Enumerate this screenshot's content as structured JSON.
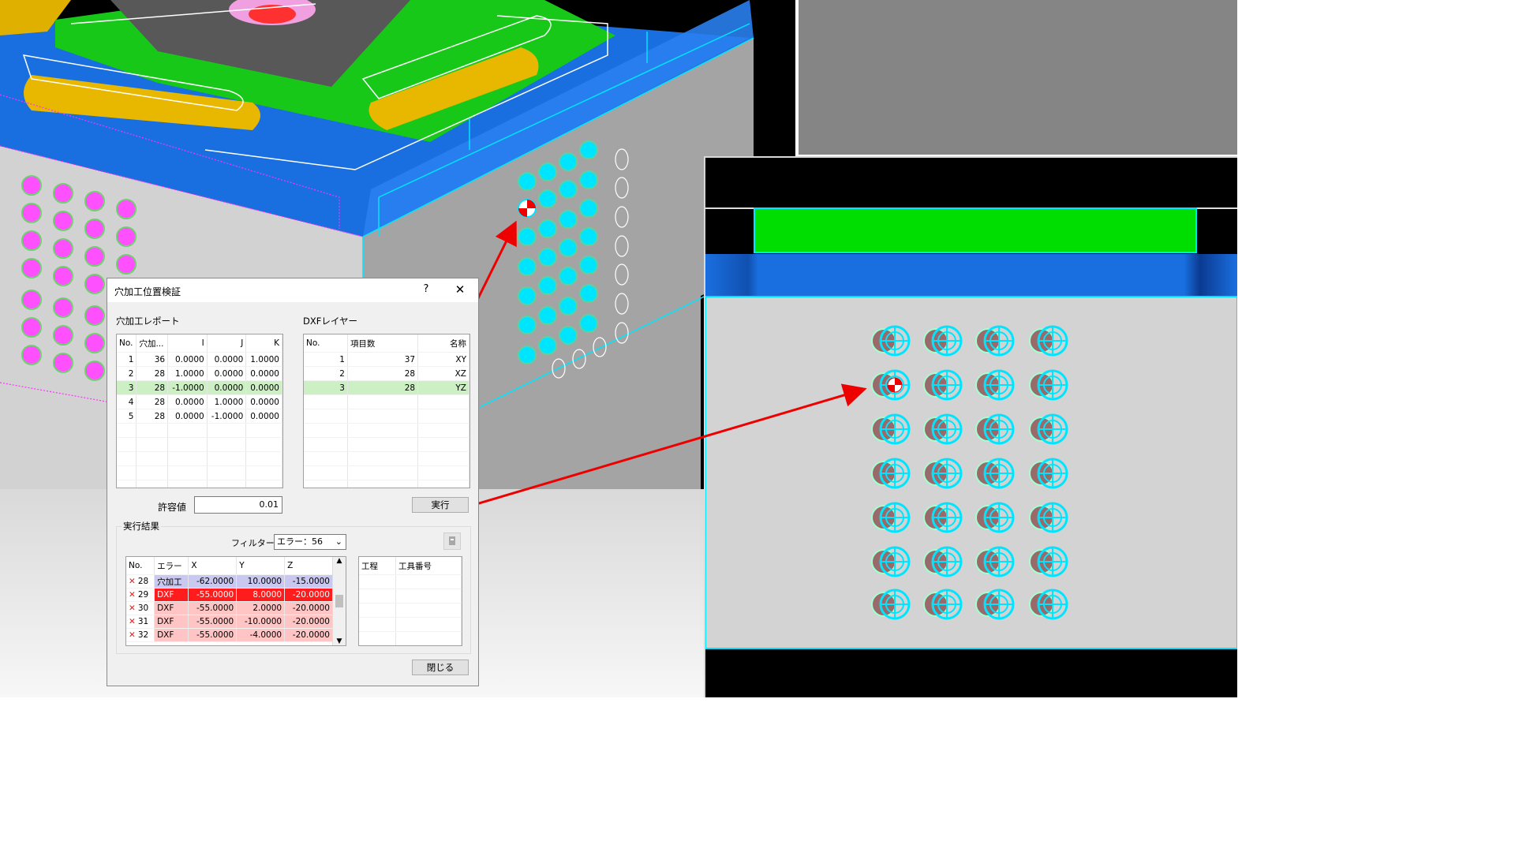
{
  "dialog": {
    "title": "穴加工位置検証",
    "help_label": "?",
    "close_icon_label": "✕",
    "hole_report": {
      "label": "穴加工レポート",
      "columns": [
        "No.",
        "穴加...",
        "I",
        "J",
        "K"
      ],
      "rows": [
        [
          "1",
          "36",
          "0.0000",
          "0.0000",
          "1.0000"
        ],
        [
          "2",
          "28",
          "1.0000",
          "0.0000",
          "0.0000"
        ],
        [
          "3",
          "28",
          "-1.0000",
          "0.0000",
          "0.0000"
        ],
        [
          "4",
          "28",
          "0.0000",
          "1.0000",
          "0.0000"
        ],
        [
          "5",
          "28",
          "0.0000",
          "-1.0000",
          "0.0000"
        ]
      ],
      "selected_row": 3
    },
    "dxf_layer": {
      "label": "DXFレイヤー",
      "columns": [
        "No.",
        "項目数",
        "名称"
      ],
      "rows": [
        [
          "1",
          "37",
          "XY"
        ],
        [
          "2",
          "28",
          "XZ"
        ],
        [
          "3",
          "28",
          "YZ"
        ]
      ],
      "selected_row": 3
    },
    "tolerance_label": "許容値",
    "tolerance_value": "0.01",
    "run_button": "実行",
    "results": {
      "label": "実行結果",
      "filter_label": "フィルター",
      "filter_value": "エラー：56",
      "columns": [
        "No.",
        "エラー",
        "X",
        "Y",
        "Z"
      ],
      "rows": [
        [
          "28",
          "穴加工",
          "-62.0000",
          "10.0000",
          "-15.0000"
        ],
        [
          "29",
          "DXF",
          "-55.0000",
          "8.0000",
          "-20.0000"
        ],
        [
          "30",
          "DXF",
          "-55.0000",
          "2.0000",
          "-20.0000"
        ],
        [
          "31",
          "DXF",
          "-55.0000",
          "-10.0000",
          "-20.0000"
        ],
        [
          "32",
          "DXF",
          "-55.0000",
          "-4.0000",
          "-20.0000"
        ]
      ],
      "side_columns": [
        "工程",
        "工具番号"
      ]
    },
    "close_button": "閉じる"
  },
  "colors": {
    "accent_cyan": "#00e5ff",
    "green_face": "#00dd00",
    "blue_face": "#1a6fe0",
    "error_red": "#ff1c1c",
    "arrow_red": "#ee0000"
  }
}
